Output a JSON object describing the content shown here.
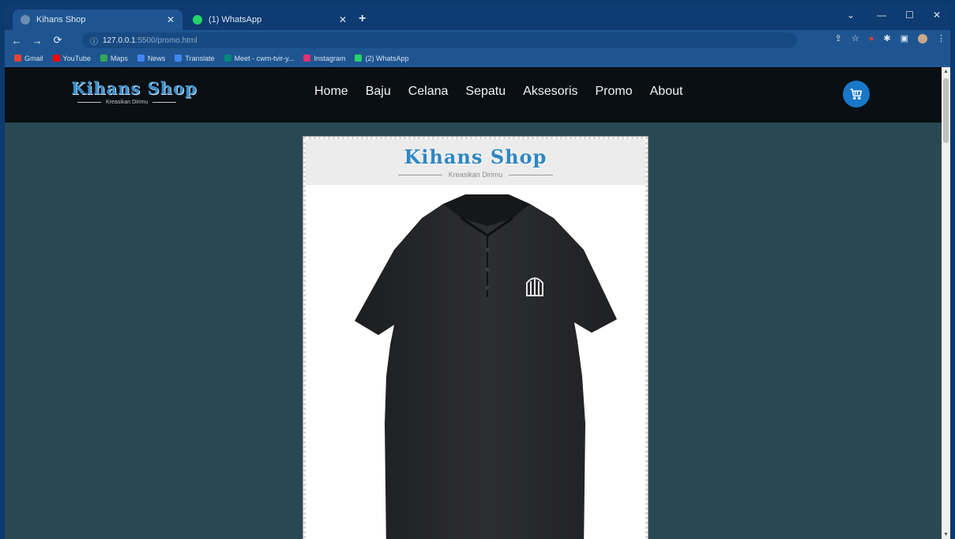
{
  "browser": {
    "tabs": [
      {
        "title": "Kihans Shop",
        "active": true,
        "favicon_color": "#6c8fb3"
      },
      {
        "title": "(1) WhatsApp",
        "active": false,
        "favicon_color": "#25d366"
      }
    ],
    "url": {
      "host": "127.0.0.1",
      "path": ":5500/promo.html"
    },
    "bookmarks": [
      {
        "label": "Gmail",
        "color": "#ea4335"
      },
      {
        "label": "YouTube",
        "color": "#ff0000"
      },
      {
        "label": "Maps",
        "color": "#34a853"
      },
      {
        "label": "News",
        "color": "#4285f4"
      },
      {
        "label": "Translate",
        "color": "#4285f4"
      },
      {
        "label": "Meet - cwm-tvir-y...",
        "color": "#00897b"
      },
      {
        "label": "Instagram",
        "color": "#e1306c"
      },
      {
        "label": "(2) WhatsApp",
        "color": "#25d366"
      }
    ]
  },
  "site": {
    "logo": {
      "name": "Kihans Shop",
      "tagline": "Kreasikan Dirimu"
    },
    "menu": [
      "Home",
      "Baju",
      "Celana",
      "Sepatu",
      "Aksesoris",
      "Promo",
      "About"
    ],
    "accent": "#1978c8",
    "background": "#284853"
  },
  "product": {
    "brand_name": "Kihans Shop",
    "brand_tagline": "Kreasikan Dirimu",
    "image": "black-polo-shirt"
  }
}
